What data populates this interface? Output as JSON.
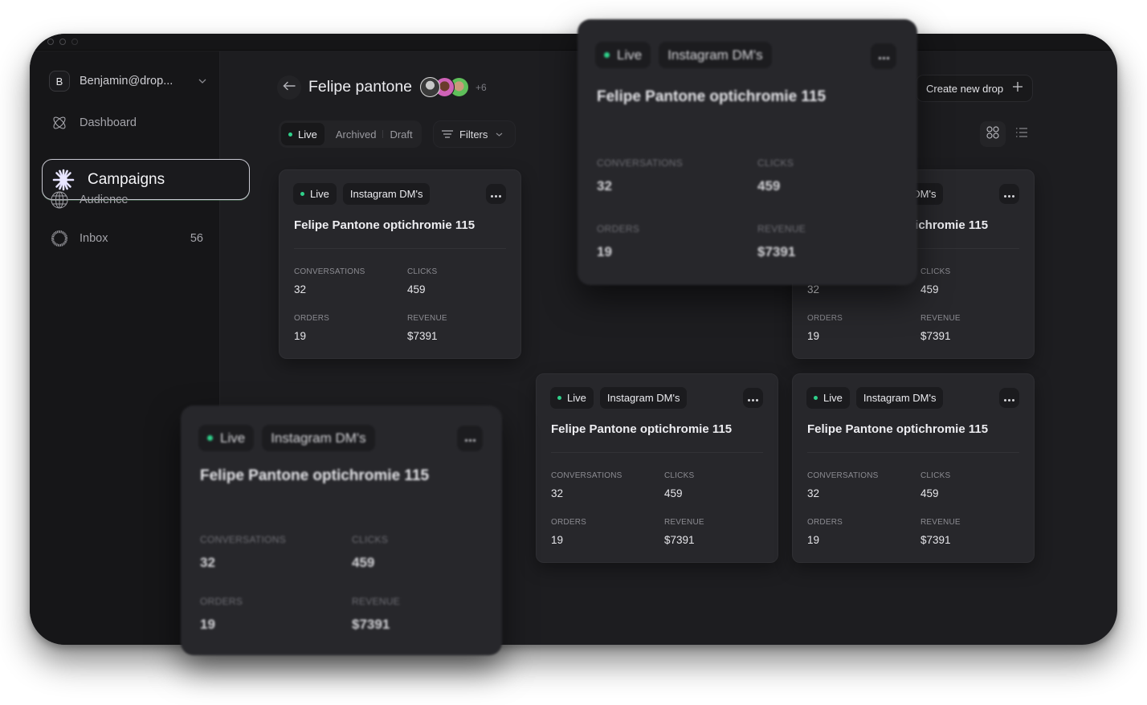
{
  "window": {
    "traffic_lights": [
      "close",
      "minimize",
      "zoom"
    ]
  },
  "sidebar": {
    "account": {
      "initial": "B",
      "name": "Benjamin@drop...",
      "icon": "chevron-down-icon"
    },
    "items": [
      {
        "label": "Dashboard",
        "icon": "atom-icon",
        "active": false,
        "count": ""
      },
      {
        "label": "Campaigns",
        "icon": "sparkle-star-icon",
        "active": true,
        "count": ""
      },
      {
        "label": "Audience",
        "icon": "globe-icon",
        "active": false,
        "count": ""
      },
      {
        "label": "Inbox",
        "icon": "ring-icon",
        "active": false,
        "count": "56"
      }
    ]
  },
  "header": {
    "back_icon": "arrow-left-icon",
    "title": "Felipe pantone",
    "members_more": "+6",
    "create_button": "Create new drop",
    "create_icon": "plus-icon"
  },
  "filters": {
    "status_tabs": [
      {
        "label": "Live",
        "active": true
      },
      {
        "label": "Archived",
        "active": false
      },
      {
        "label": "Draft",
        "active": false
      }
    ],
    "filters_label": "Filters",
    "view_modes": [
      {
        "name": "grid",
        "active": true
      },
      {
        "name": "list",
        "active": false
      }
    ]
  },
  "colors": {
    "live_dot": "#2fd08a",
    "window_bg": "#1d1d20",
    "card_bg": "#27272b",
    "accent_active_icon": "#d9d6ff"
  },
  "cards": [
    {
      "status": "Live",
      "channel": "Instagram DM's",
      "title": "Felipe Pantone optichromie 115",
      "stats": [
        {
          "label": "CONVERSATIONS",
          "value": "32"
        },
        {
          "label": "CLICKS",
          "value": "459"
        },
        {
          "label": "ORDERS",
          "value": "19"
        },
        {
          "label": "REVENUE",
          "value": "$7391"
        }
      ]
    },
    {
      "status": "Live",
      "channel": "Instagram DM's",
      "title": "Felipe Pantone optichromie 115",
      "stats": [
        {
          "label": "CONVERSATIONS",
          "value": "32"
        },
        {
          "label": "CLICKS",
          "value": "459"
        },
        {
          "label": "ORDERS",
          "value": "19"
        },
        {
          "label": "REVENUE",
          "value": "$7391"
        }
      ]
    },
    {
      "status": "Live",
      "channel": "Instagram DM's",
      "title": "Felipe Pantone optichromie 115",
      "stats": [
        {
          "label": "CONVERSATIONS",
          "value": "32"
        },
        {
          "label": "CLICKS",
          "value": "459"
        },
        {
          "label": "ORDERS",
          "value": "19"
        },
        {
          "label": "REVENUE",
          "value": "$7391"
        }
      ]
    },
    {
      "status": "Live",
      "channel": "Instagram DM's",
      "title": "Felipe Pantone optichromie 115",
      "stats": [
        {
          "label": "CONVERSATIONS",
          "value": "32"
        },
        {
          "label": "CLICKS",
          "value": "459"
        },
        {
          "label": "ORDERS",
          "value": "19"
        },
        {
          "label": "REVENUE",
          "value": "$7391"
        }
      ]
    }
  ],
  "floating_cards": [
    {
      "status": "Live",
      "channel": "Instagram DM's",
      "title": "Felipe Pantone optichromie 115",
      "stats": [
        {
          "label": "CONVERSATIONS",
          "value": "32"
        },
        {
          "label": "CLICKS",
          "value": "459"
        },
        {
          "label": "ORDERS",
          "value": "19"
        },
        {
          "label": "REVENUE",
          "value": "$7391"
        }
      ]
    },
    {
      "status": "Live",
      "channel": "Instagram DM's",
      "title": "Felipe Pantone optichromie 115",
      "stats": [
        {
          "label": "CONVERSATIONS",
          "value": "32"
        },
        {
          "label": "CLICKS",
          "value": "459"
        },
        {
          "label": "ORDERS",
          "value": "19"
        },
        {
          "label": "REVENUE",
          "value": "$7391"
        }
      ]
    }
  ]
}
